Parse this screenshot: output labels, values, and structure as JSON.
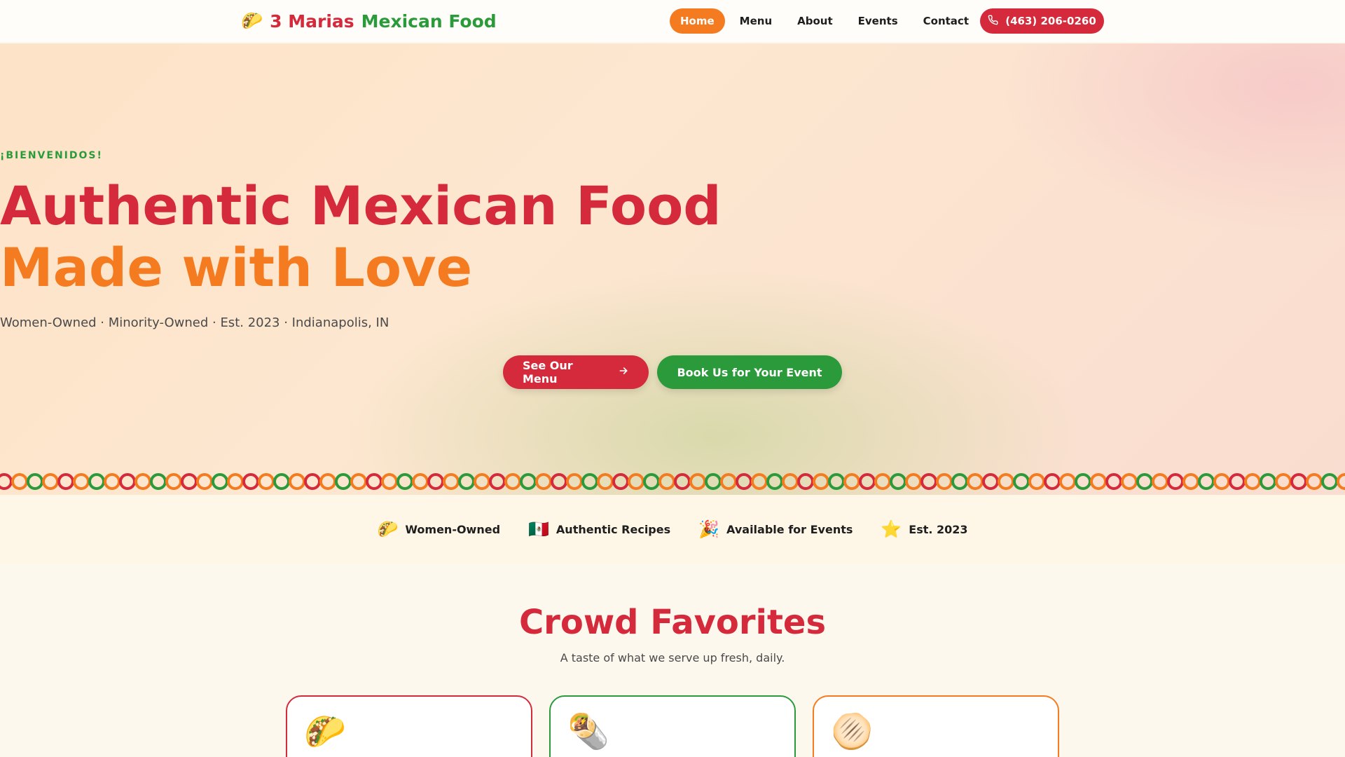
{
  "nav": {
    "brand_icon": "taco-emoji",
    "brand_part1": "3 Marias",
    "brand_part2": "Mexican Food",
    "links": [
      {
        "label": "Home",
        "active": true
      },
      {
        "label": "Menu",
        "active": false
      },
      {
        "label": "About",
        "active": false
      },
      {
        "label": "Events",
        "active": false
      },
      {
        "label": "Contact",
        "active": false
      }
    ],
    "phone_icon": "phone-icon",
    "phone": "(463) 206-0260"
  },
  "hero": {
    "eyebrow": "¡BIENVENIDOS!",
    "headline_line1": "Authentic Mexican Food",
    "headline_line2": "Made with Love",
    "tagline": "Women-Owned · Minority-Owned · Est. 2023 · Indianapolis, IN",
    "primary_button": "See Our Menu",
    "primary_button_icon": "arrow-right-icon",
    "secondary_button": "Book Us for Your Event"
  },
  "features": [
    {
      "emoji": "🌮",
      "label": "Women-Owned"
    },
    {
      "emoji": "🇲🇽",
      "label": "Authentic Recipes"
    },
    {
      "emoji": "🎉",
      "label": "Available for Events"
    },
    {
      "emoji": "⭐",
      "label": "Est. 2023"
    }
  ],
  "favorites": {
    "title": "Crowd Favorites",
    "subtitle": "A taste of what we serve up fresh, daily.",
    "cards": [
      {
        "emoji": "🌮",
        "icon": "taco-emoji"
      },
      {
        "emoji": "🌯",
        "icon": "burrito-emoji"
      },
      {
        "emoji": "🫓",
        "icon": "flatbread-emoji"
      }
    ]
  },
  "colors": {
    "red": "#d42a3c",
    "orange": "#f57b20",
    "green": "#2a9a3a"
  }
}
